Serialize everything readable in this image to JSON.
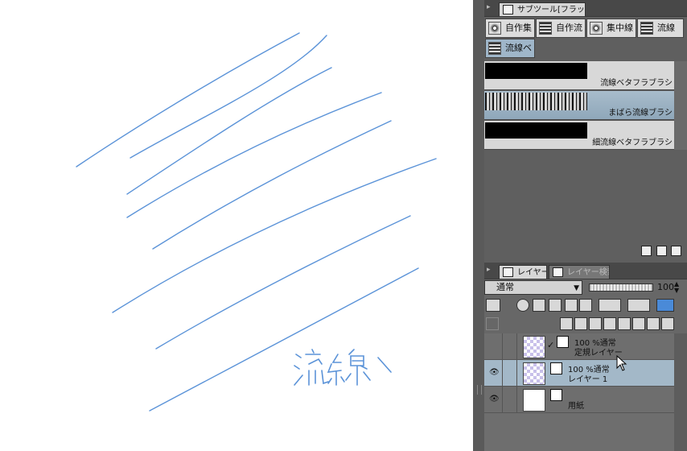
{
  "canvas": {
    "handwriting": "流線",
    "stroke_color": "#5b93d8"
  },
  "subtool_panel": {
    "tab_label": "サブツール[フラッシュ]",
    "groups": [
      {
        "label": "自作集",
        "icon": "burst-icon"
      },
      {
        "label": "自作流",
        "icon": "lines-icon"
      },
      {
        "label": "集中線",
        "icon": "burst-icon"
      },
      {
        "label": "流線",
        "icon": "lines-icon"
      },
      {
        "label": "流線ベ",
        "icon": "lines-icon",
        "active": true
      }
    ],
    "brushes": [
      {
        "name": "流線ベタフラブラシ",
        "selected": false
      },
      {
        "name": "まばら流線ブラシ",
        "selected": true
      },
      {
        "name": "細流線ベタフラブラシ",
        "selected": false
      }
    ]
  },
  "layer_panel": {
    "tab_layer": "レイヤー",
    "tab_search": "レイヤー検索",
    "blend_mode": "通常",
    "opacity": "100",
    "layers": [
      {
        "line1": "100 %通常",
        "line2": "定規レイヤー",
        "selected": false,
        "visible": false
      },
      {
        "line1": "100 %通常",
        "line2": "レイヤー 1",
        "selected": true,
        "visible": true
      },
      {
        "line1": "",
        "line2": "用紙",
        "selected": false,
        "visible": true
      }
    ]
  }
}
